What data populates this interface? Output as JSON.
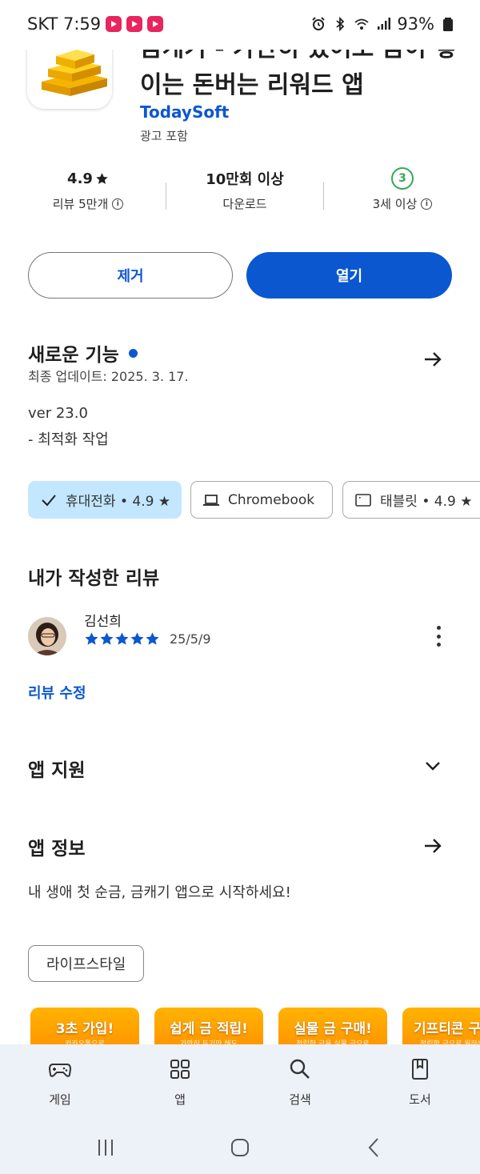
{
  "status_bar": {
    "carrier_time": "SKT 7:59",
    "battery": "93%",
    "notification_icons": [
      "app-notification-icon",
      "app-notification-icon",
      "app-notification-icon"
    ],
    "system_icons": [
      "alarm-icon",
      "bluetooth-icon",
      "wifi-icon",
      "signal-icon",
      "battery-icon"
    ]
  },
  "app": {
    "title": "금캐기 - 가만히 있어도 금이 쌓이는 돈버는 리워드 앱",
    "developer": "TodaySoft",
    "ad_notice": "광고 포함"
  },
  "stats": {
    "rating": "4.9",
    "rating_label": "리뷰 5만개",
    "downloads": "10만회 이상",
    "downloads_label": "다운로드",
    "age_rating": "3",
    "age_label": "3세 이상"
  },
  "actions": {
    "remove": "제거",
    "open": "열기"
  },
  "whats_new": {
    "title": "새로운 기능",
    "updated": "최종 업데이트: 2025. 3. 17.",
    "version": "ver 23.0",
    "notes": "- 최적화 작업"
  },
  "devices": [
    {
      "label": "휴대전화 • 4.9 ★",
      "selected": true,
      "icon": "check-icon"
    },
    {
      "label": "Chromebook",
      "selected": false,
      "icon": "laptop-icon"
    },
    {
      "label": "태블릿 • 4.9 ★",
      "selected": false,
      "icon": "tablet-icon"
    }
  ],
  "my_review": {
    "title": "내가 작성한 리뷰",
    "reviewer": "김선희",
    "stars": 5,
    "date": "25/5/9",
    "edit_label": "리뷰 수정"
  },
  "app_support": {
    "title": "앱 지원"
  },
  "app_info": {
    "title": "앱 정보",
    "description": "내 생애 첫 순금, 금캐기 앱으로 시작하세요!",
    "category": "라이프스타일"
  },
  "banners": [
    {
      "title": "3초 가입!",
      "sub": "카카오톡으로"
    },
    {
      "title": "쉽게 금 적립!",
      "sub": "가만히 두기만 해도"
    },
    {
      "title": "실물 금 구매!",
      "sub": "적립한 금을 실물 금으로"
    },
    {
      "title": "기프티콘 구",
      "sub": "적립한 금으로 원하는"
    }
  ],
  "bottom_nav": [
    {
      "label": "게임",
      "icon": "gamepad-icon"
    },
    {
      "label": "앱",
      "icon": "apps-grid-icon"
    },
    {
      "label": "검색",
      "icon": "search-icon"
    },
    {
      "label": "도서",
      "icon": "book-icon"
    }
  ],
  "colors": {
    "accent": "#0b57d0",
    "chip_selected": "#c2e7ff",
    "nav_background": "#edf1f8",
    "age_badge": "#34a853",
    "banner": "#ffa000"
  }
}
